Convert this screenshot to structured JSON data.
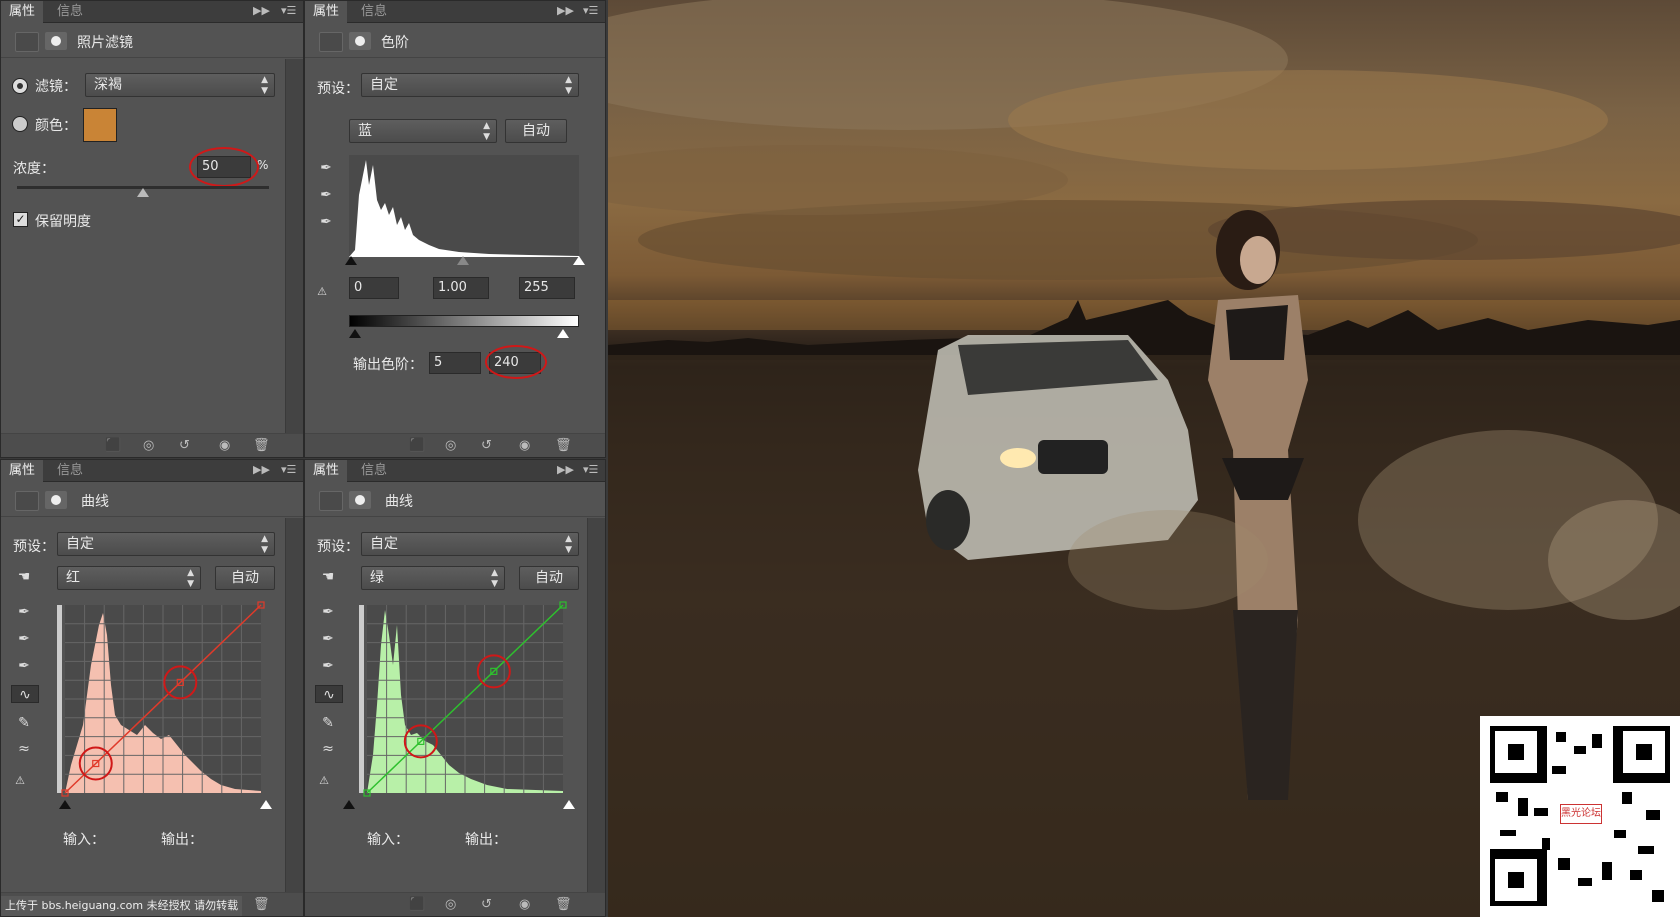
{
  "panels": {
    "photo_filter": {
      "tabs": [
        "属性",
        "信息"
      ],
      "title": "照片滤镜",
      "filter_label": "滤镜：",
      "filter_value": "深褐",
      "color_label": "颜色：",
      "color_swatch": "#c98436",
      "density_label": "浓度：",
      "density_value": "50",
      "density_unit": "%",
      "density_percent": 50,
      "preserve_luminosity_label": "保留明度"
    },
    "levels": {
      "tabs": [
        "属性",
        "信息"
      ],
      "title": "色阶",
      "preset_label": "预设：",
      "preset_value": "自定",
      "channel_value": "蓝",
      "auto_label": "自动",
      "input_black": "0",
      "input_gamma": "1.00",
      "input_white": "255",
      "output_label": "输出色阶：",
      "output_black": "5",
      "output_white": "240"
    },
    "curves_red": {
      "tabs": [
        "属性",
        "信息"
      ],
      "title": "曲线",
      "preset_label": "预设：",
      "preset_value": "自定",
      "channel_value": "红",
      "auto_label": "自动",
      "input_label": "输入：",
      "output_label": "输出：",
      "curve_color": "#e03a2a",
      "histogram_color": "#f5c0b0",
      "curve_points": [
        [
          0,
          0
        ],
        [
          40,
          40
        ],
        [
          150,
          150
        ],
        [
          255,
          255
        ]
      ]
    },
    "curves_green": {
      "tabs": [
        "属性",
        "信息"
      ],
      "title": "曲线",
      "preset_label": "预设：",
      "preset_value": "自定",
      "channel_value": "绿",
      "auto_label": "自动",
      "input_label": "输入：",
      "output_label": "输出：",
      "curve_color": "#2ec02e",
      "histogram_color": "#b8f0a8",
      "curve_points": [
        [
          0,
          0
        ],
        [
          70,
          70
        ],
        [
          165,
          165
        ],
        [
          255,
          255
        ]
      ]
    }
  },
  "watermark": "上传于 bbs.heiguang.com  未经授权  请勿转载",
  "qr_label": "黑光论坛",
  "icons": [
    "camera-icon",
    "mask-icon",
    "levels-icon",
    "curves-icon",
    "eyedropper-icon",
    "trash-icon",
    "eye-icon",
    "reset-icon",
    "clip-icon"
  ]
}
